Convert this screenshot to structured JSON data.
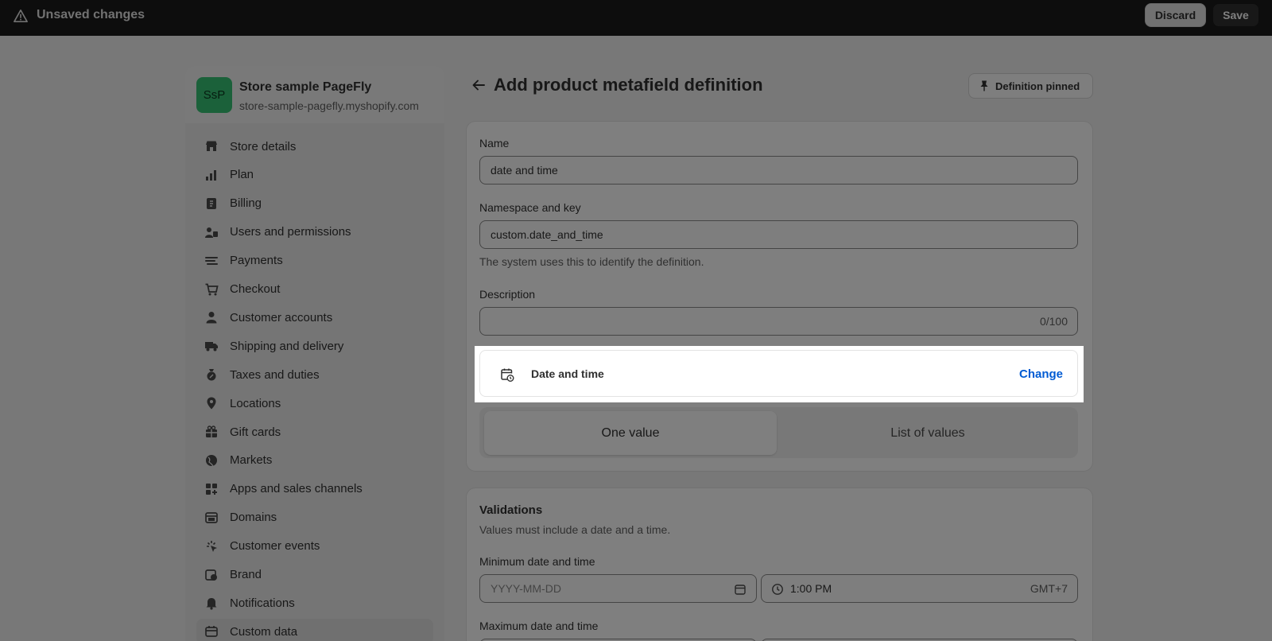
{
  "topbar": {
    "title": "Unsaved changes",
    "discard_label": "Discard",
    "save_label": "Save"
  },
  "store": {
    "initials": "SsP",
    "name": "Store sample PageFly",
    "url": "store-sample-pagefly.myshopify.com",
    "avatar_color": "#36c275"
  },
  "sidebar": {
    "items": [
      {
        "label": "Store details",
        "icon": "store-icon"
      },
      {
        "label": "Plan",
        "icon": "plan-icon"
      },
      {
        "label": "Billing",
        "icon": "billing-icon"
      },
      {
        "label": "Users and permissions",
        "icon": "users-icon"
      },
      {
        "label": "Payments",
        "icon": "payments-icon"
      },
      {
        "label": "Checkout",
        "icon": "cart-icon"
      },
      {
        "label": "Customer accounts",
        "icon": "person-icon"
      },
      {
        "label": "Shipping and delivery",
        "icon": "truck-icon"
      },
      {
        "label": "Taxes and duties",
        "icon": "tax-icon"
      },
      {
        "label": "Locations",
        "icon": "location-icon"
      },
      {
        "label": "Gift cards",
        "icon": "gift-icon"
      },
      {
        "label": "Markets",
        "icon": "globe-icon"
      },
      {
        "label": "Apps and sales channels",
        "icon": "apps-icon"
      },
      {
        "label": "Domains",
        "icon": "domain-icon"
      },
      {
        "label": "Customer events",
        "icon": "cursor-icon"
      },
      {
        "label": "Brand",
        "icon": "brand-icon"
      },
      {
        "label": "Notifications",
        "icon": "bell-icon"
      },
      {
        "label": "Custom data",
        "icon": "custom-data-icon",
        "active": true
      }
    ]
  },
  "main": {
    "title": "Add product metafield definition",
    "pin_label": "Definition pinned",
    "name_label": "Name",
    "name_value": "date and time",
    "namespace_label": "Namespace and key",
    "namespace_value": "custom.date_and_time",
    "namespace_help": "The system uses this to identify the definition.",
    "description_label": "Description",
    "description_value": "",
    "description_counter": "0/100",
    "type_label": "Date and time",
    "type_change": "Change",
    "one_value": "One value",
    "list_of_values": "List of values"
  },
  "validations": {
    "title": "Validations",
    "help": "Values must include a date and a time.",
    "min_label": "Minimum date and time",
    "date_placeholder": "YYYY-MM-DD",
    "time_value": "1:00 PM",
    "timezone": "GMT+7",
    "max_label": "Maximum date and time"
  },
  "colors": {
    "link": "#005bd3",
    "primary_button": "#303030"
  }
}
